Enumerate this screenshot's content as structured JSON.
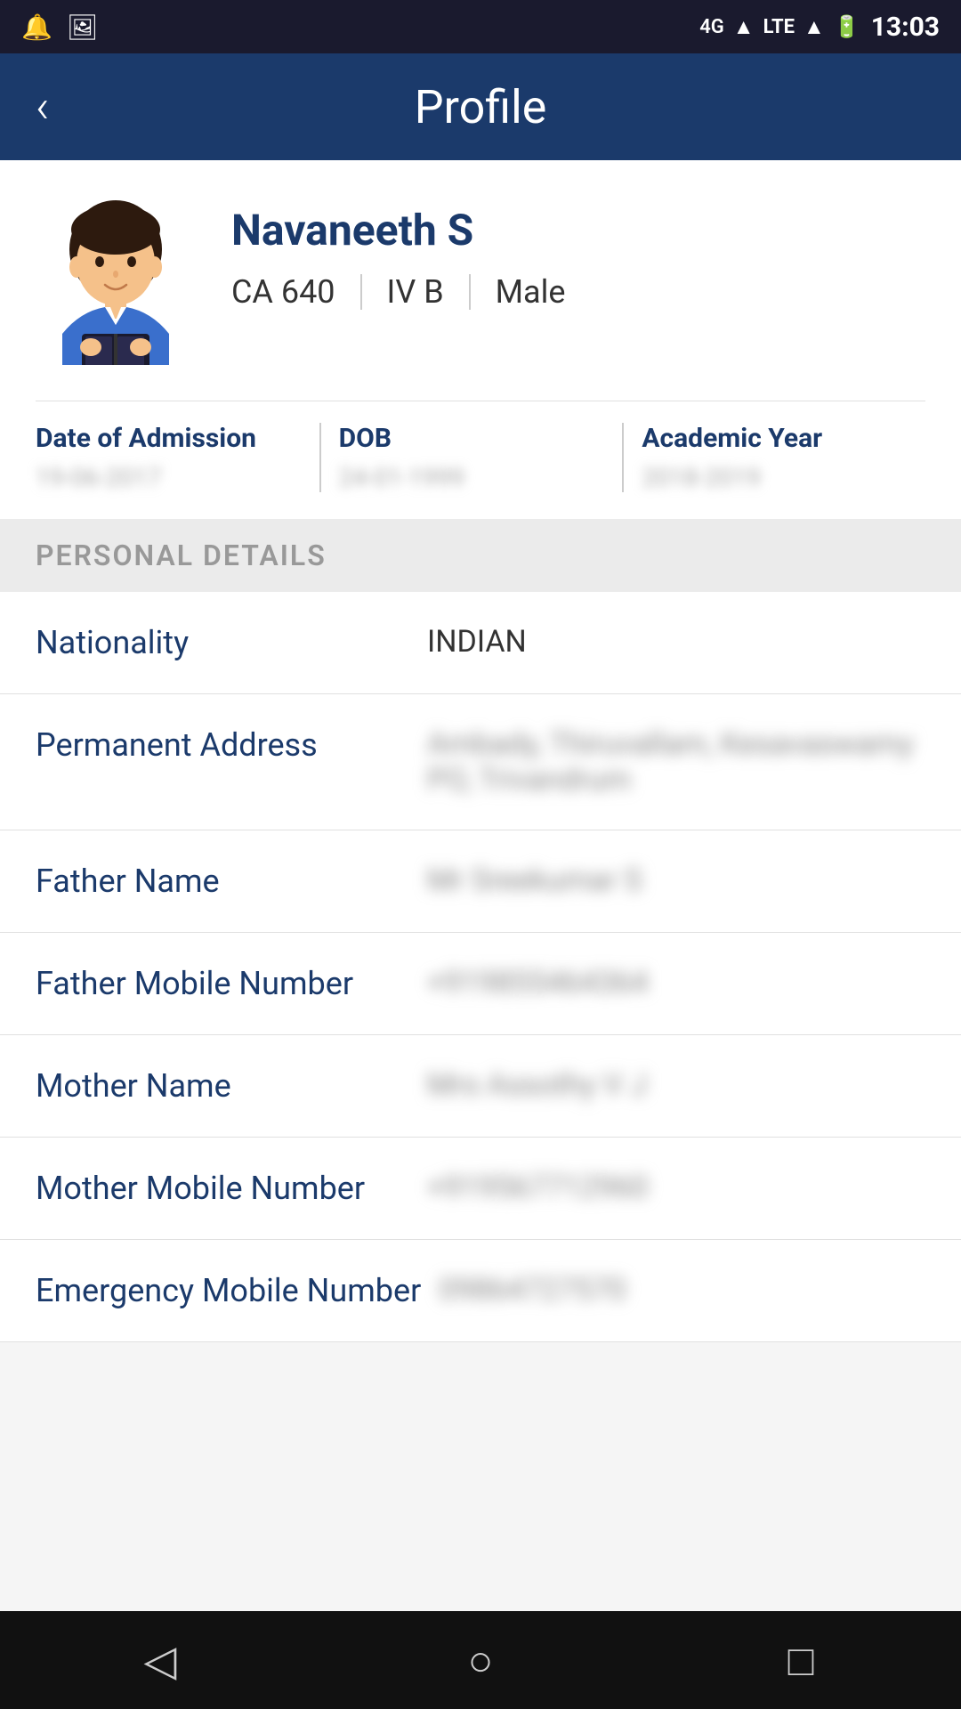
{
  "statusBar": {
    "time": "13:03",
    "network": "4G LTE",
    "icons": [
      "bell",
      "image"
    ]
  },
  "navBar": {
    "backLabel": "‹",
    "title": "Profile"
  },
  "profile": {
    "name": "Navaneeth S",
    "rollNumber": "CA 640",
    "section": "IV B",
    "gender": "Male",
    "dateOfAdmissionLabel": "Date of Admission",
    "dateOfAdmissionValue": "19-06-2017",
    "dobLabel": "DOB",
    "dobValue": "24-01-1999",
    "academicYearLabel": "Academic Year",
    "academicYearValue": "2018-2019"
  },
  "personalDetails": {
    "sectionTitle": "PERSONAL DETAILS",
    "items": [
      {
        "label": "Nationality",
        "value": "INDIAN",
        "blurred": false
      },
      {
        "label": "Permanent Address",
        "value": "Ambady, Thiruvallam, Kesavaswamy PO, Trivandrum",
        "blurred": true
      },
      {
        "label": "Father Name",
        "value": "Mr Sreekumar S",
        "blurred": true
      },
      {
        "label": "Father Mobile Number",
        "value": "+919855464364",
        "blurred": true
      },
      {
        "label": "Mother Name",
        "value": "Mrs Assothy V J",
        "blurred": true
      },
      {
        "label": "Mother Mobile Number",
        "value": "+919567712960",
        "blurred": true
      },
      {
        "label": "Emergency Mobile Number",
        "value": "09864727570",
        "blurred": true
      }
    ]
  },
  "bottomNav": {
    "backIcon": "◁",
    "homeIcon": "○",
    "recentIcon": "□"
  }
}
